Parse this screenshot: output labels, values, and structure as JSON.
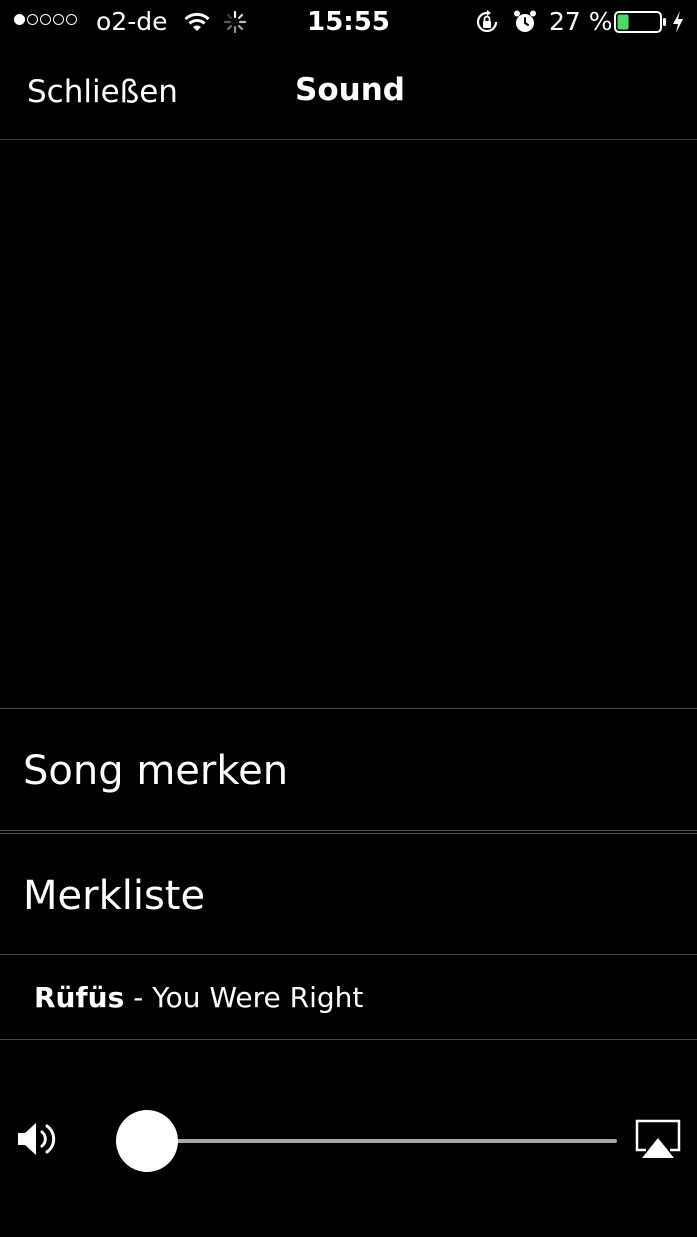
{
  "status_bar": {
    "carrier": "o2-de",
    "time": "15:55",
    "battery_percent": "27 %",
    "signal_strength": 1,
    "battery_level": 0.27,
    "battery_color": "#4cd964",
    "icons": [
      "wifi-icon",
      "activity-icon",
      "orientation-lock-icon",
      "alarm-icon",
      "battery-icon",
      "charging-bolt-icon"
    ]
  },
  "nav": {
    "close_label": "Schließen",
    "title": "Sound"
  },
  "actions": {
    "save_song_label": "Song merken",
    "watchlist_label": "Merkliste"
  },
  "now_playing": {
    "artist": "Rüfüs",
    "separator": " - ",
    "track": "You Were Right"
  },
  "volume": {
    "level": 0,
    "icons": [
      "speaker-icon",
      "airplay-icon"
    ]
  },
  "colors": {
    "background": "#000000",
    "text": "#ffffff",
    "divider": "#4a4a4a",
    "track": "#a8a8a8"
  }
}
